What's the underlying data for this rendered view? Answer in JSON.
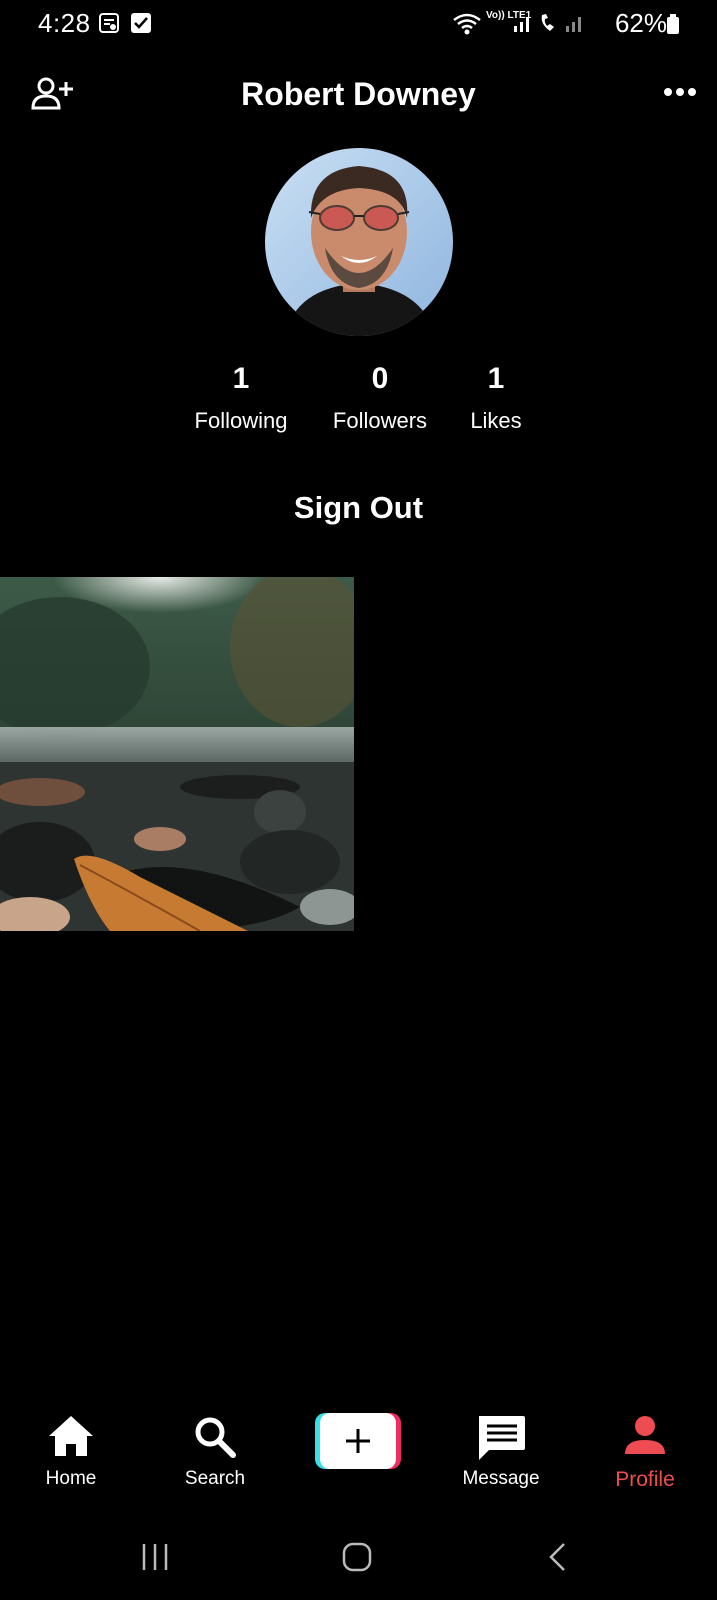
{
  "status_bar": {
    "time": "4:28",
    "battery_percent": "62%",
    "network_label": "Vo)) LTE1"
  },
  "header": {
    "title": "Robert Downey",
    "add_user_icon": "add-user-icon",
    "more_icon": "more-horizontal-icon"
  },
  "profile": {
    "stats": [
      {
        "value": "1",
        "label": "Following"
      },
      {
        "value": "0",
        "label": "Followers"
      },
      {
        "value": "1",
        "label": "Likes"
      }
    ],
    "sign_out_label": "Sign Out"
  },
  "bottom_nav": {
    "items": [
      {
        "label": "Home",
        "icon": "home-icon"
      },
      {
        "label": "Search",
        "icon": "search-icon"
      },
      {
        "label": "",
        "icon": "plus-icon"
      },
      {
        "label": "Message",
        "icon": "message-icon"
      },
      {
        "label": "Profile",
        "icon": "person-icon"
      }
    ],
    "active_color": "#ee4c53"
  },
  "colors": {
    "background": "#000000",
    "text": "#ffffff",
    "accent": "#ee4c53",
    "create_cyan": "#37e0e8",
    "create_pink": "#ee2c62"
  }
}
